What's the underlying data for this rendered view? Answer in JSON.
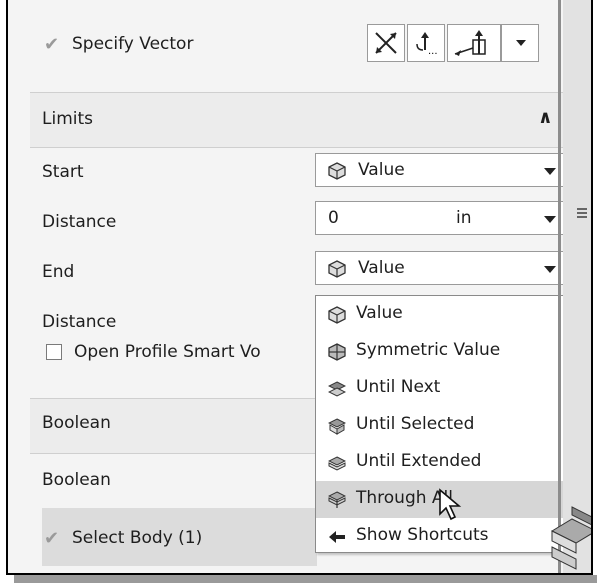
{
  "specify_vector": {
    "label": "Specify Vector"
  },
  "limits": {
    "header": "Limits",
    "start_label": "Start",
    "start_value": "Value",
    "distance1_label": "Distance",
    "distance1_value": "0",
    "distance1_unit": "in",
    "end_label": "End",
    "end_value": "Value",
    "distance2_label": "Distance",
    "open_profile_label": "Open Profile Smart Vo"
  },
  "menu": {
    "items": [
      {
        "label": "Value",
        "icon": "value-icon"
      },
      {
        "label": "Symmetric Value",
        "icon": "symmetric-value-icon"
      },
      {
        "label": "Until Next",
        "icon": "until-next-icon"
      },
      {
        "label": "Until Selected",
        "icon": "until-selected-icon"
      },
      {
        "label": "Until Extended",
        "icon": "until-extended-icon"
      },
      {
        "label": "Through All",
        "icon": "through-all-icon",
        "highlighted": true
      },
      {
        "label": "Show Shortcuts",
        "icon": "show-shortcuts-icon"
      }
    ]
  },
  "boolean": {
    "header": "Boolean",
    "boolean_label": "Boolean",
    "select_body_label": "Select Body (1)"
  }
}
